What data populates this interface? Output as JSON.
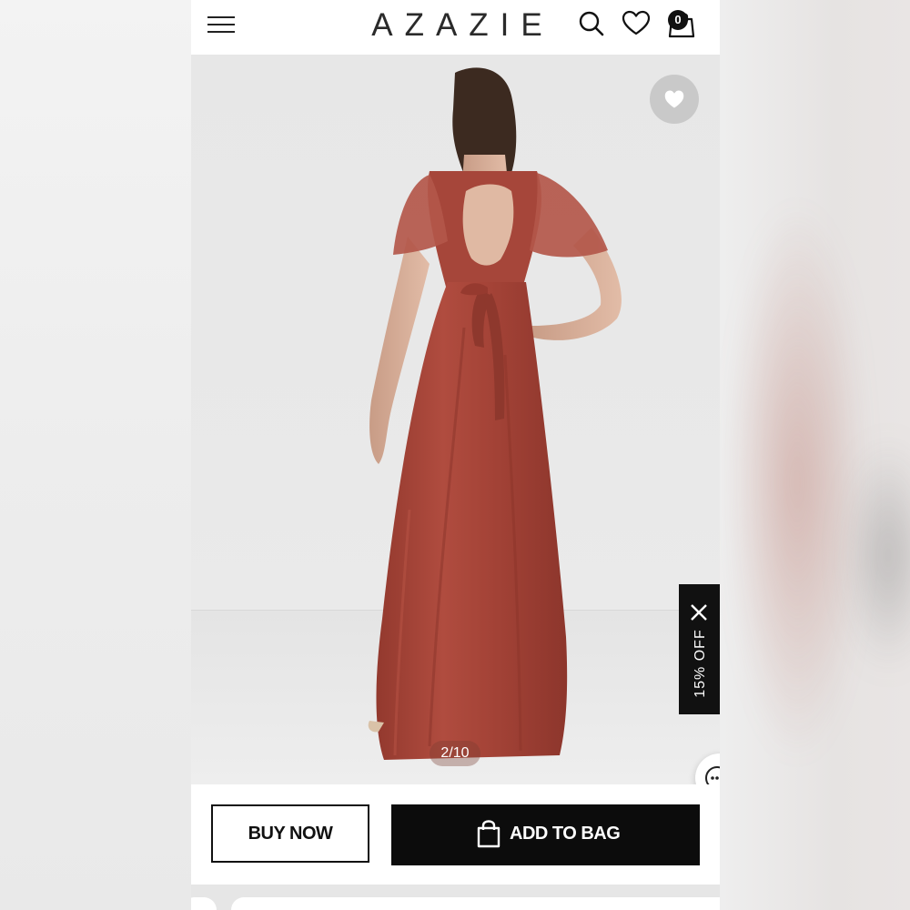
{
  "header": {
    "logo": "AZAZIE",
    "bag_count": "0"
  },
  "icons": {
    "menu": "hamburger-menu-icon",
    "search": "search-icon",
    "wishlist": "heart-icon",
    "bag": "shopping-bag-icon",
    "favorite": "heart-filled-icon",
    "close": "close-icon",
    "chat": "chat-bubble-icon"
  },
  "gallery": {
    "counter": "2/10"
  },
  "promo": {
    "text": "15% OFF"
  },
  "actions": {
    "buy_now": "BUY NOW",
    "add_to_bag": "ADD TO BAG"
  },
  "colors": {
    "dress": "#a8473a",
    "background": "#e9e9e9",
    "button_dark": "#0c0c0c"
  }
}
